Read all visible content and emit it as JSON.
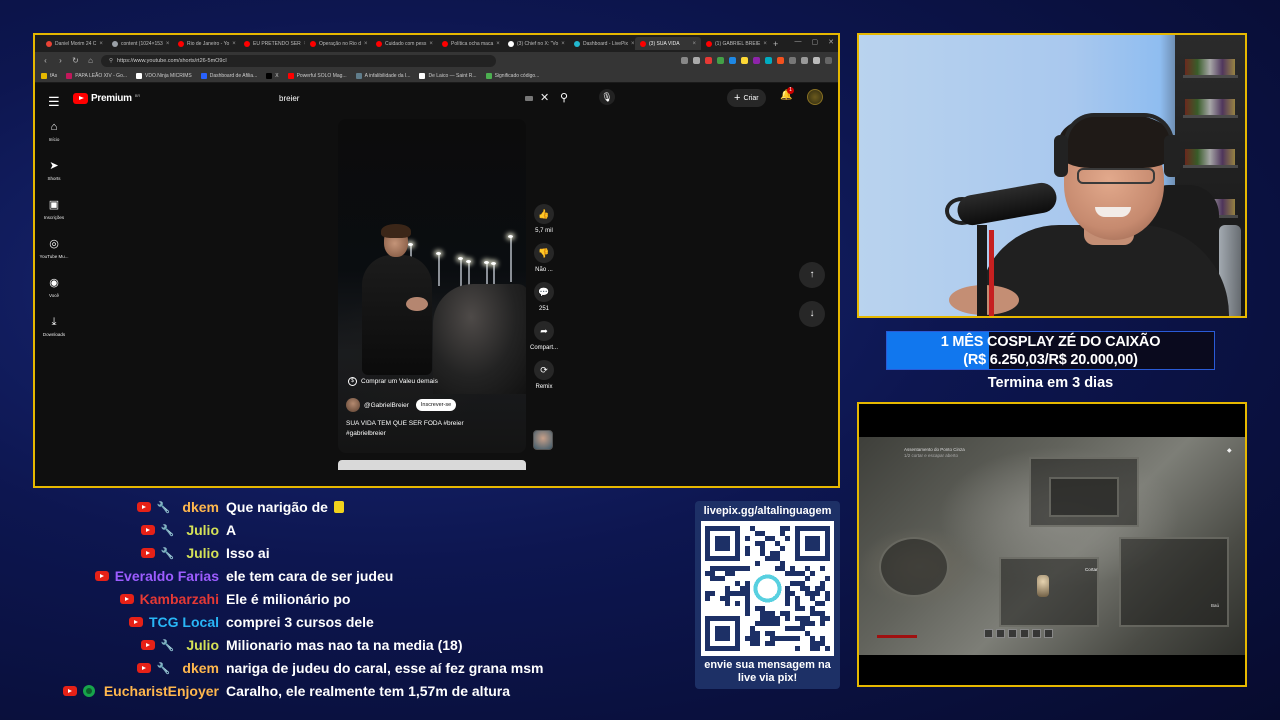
{
  "browser": {
    "tabs": [
      {
        "label": "Daniel Morim 24 C",
        "color": "#ea4335",
        "active": false
      },
      {
        "label": "content (1024×153",
        "color": "#9aa0a6",
        "active": false
      },
      {
        "label": "Rio de Janeiro - Yo",
        "color": "#ff0000",
        "active": false
      },
      {
        "label": "EU PRETENDO SER",
        "color": "#ff0000",
        "active": false
      },
      {
        "label": "Operação no Rio d",
        "color": "#ff0000",
        "active": false
      },
      {
        "label": "Cuidado com pess",
        "color": "#ff0000",
        "active": false
      },
      {
        "label": "Política ocha maca",
        "color": "#ff0000",
        "active": false
      },
      {
        "label": "(3) Chief no X: \"Vo",
        "color": "#ffffff",
        "active": false
      },
      {
        "label": "Dashboard - LivePix",
        "color": "#22b8cf",
        "active": false
      },
      {
        "label": "(3) SUA VIDA",
        "color": "#ff0000",
        "active": true
      },
      {
        "label": "(1) GABRIEL BREIE",
        "color": "#ff0000",
        "active": false
      }
    ],
    "new_tab": "+",
    "window_controls": [
      "—",
      "▢",
      "✕"
    ],
    "address": "https://www.youtube.com/shorts/rt26-5mO9cI",
    "bookmarks": [
      {
        "label": "fAs",
        "color": "#e6b800"
      },
      {
        "label": "PAPA LEÃO XIV - Go...",
        "color": "#c2185b"
      },
      {
        "label": "VDO.Ninja MICRIMS",
        "color": "#ffffff"
      },
      {
        "label": "Dashboard de Afilia...",
        "color": "#2962ff"
      },
      {
        "label": "X",
        "color": "#000000"
      },
      {
        "label": "Powerful SOLO Mag...",
        "color": "#ff0000"
      },
      {
        "label": "A infalibilidade da I...",
        "color": "#607d8b"
      },
      {
        "label": "De Laico — Saint R...",
        "color": "#ffffff"
      },
      {
        "label": "Significado código...",
        "color": "#4caf50"
      }
    ]
  },
  "youtube": {
    "menu_icon": "hamburger-menu-icon",
    "logo_text": "Premium",
    "logo_region": "BR",
    "search_value": "breier",
    "create_label": "Criar",
    "notification_count": "1",
    "nav": [
      {
        "icon": "⌂",
        "icon_name": "home-icon",
        "label": "Início"
      },
      {
        "icon": "➤",
        "icon_name": "shorts-icon",
        "label": "Shorts"
      },
      {
        "icon": "▣",
        "icon_name": "subscriptions-icon",
        "label": "Inscrições"
      },
      {
        "icon": "◎",
        "icon_name": "youtube-music-icon",
        "label": "YouTube Mu..."
      },
      {
        "icon": "◉",
        "icon_name": "you-icon",
        "label": "Você"
      },
      {
        "icon": "⤓",
        "icon_name": "downloads-icon",
        "label": "Downloads"
      }
    ],
    "short": {
      "buy_label": "Comprar um Valeu demais",
      "channel": "@GabrielBreier",
      "subscribe_label": "Inscrever-se",
      "caption_line1": "SUA VIDA TEM QUE SER FODA #breier",
      "caption_line2": "#gabrielbreier"
    },
    "actions": [
      {
        "icon": "👍",
        "icon_name": "like-icon",
        "label": "5,7 mil"
      },
      {
        "icon": "👎",
        "icon_name": "dislike-icon",
        "label": "Não ..."
      },
      {
        "icon": "💬",
        "icon_name": "comment-icon",
        "label": "251"
      },
      {
        "icon": "➦",
        "icon_name": "share-icon",
        "label": "Compart..."
      },
      {
        "icon": "⟳",
        "icon_name": "remix-icon",
        "label": "Remix"
      }
    ]
  },
  "goal": {
    "line1": "1 MÊS COSPLAY ZÉ DO CAIXÃO",
    "line2": "(R$ 6.250,03/R$ 20.000,00)",
    "progress": 0.3125,
    "ends": "Termina em 3 dias"
  },
  "game": {
    "quest_title": "Assentamento do Ponto Cinza",
    "quest_sub": "1/2 cortar e escapar aberto",
    "target_label": "Cortar",
    "item_label": "Baú"
  },
  "chat": [
    {
      "user": "dkem",
      "color": "#ffb74d",
      "badges": [
        "yt",
        "wrench"
      ],
      "text": "Que narigão de",
      "emoji": true
    },
    {
      "user": "Julio",
      "color": "#d4e157",
      "badges": [
        "yt",
        "wrench"
      ],
      "text": "A"
    },
    {
      "user": "Julio",
      "color": "#d4e157",
      "badges": [
        "yt",
        "wrench"
      ],
      "text": "Isso ai"
    },
    {
      "user": "Everaldo Farias",
      "color": "#9c5cff",
      "badges": [
        "yt"
      ],
      "text": "ele tem cara de ser judeu"
    },
    {
      "user": "Kambarzahi",
      "color": "#e53935",
      "badges": [
        "yt"
      ],
      "text": "Ele é milionário po"
    },
    {
      "user": "TCG Local",
      "color": "#29b6f6",
      "badges": [
        "yt"
      ],
      "text": "comprei 3 cursos dele"
    },
    {
      "user": "Julio",
      "color": "#d4e157",
      "badges": [
        "yt",
        "wrench"
      ],
      "text": "Milionario mas nao ta na media (18)"
    },
    {
      "user": "dkem",
      "color": "#ffb74d",
      "badges": [
        "yt",
        "wrench"
      ],
      "text": "nariga de judeu do caral, esse aí fez grana msm"
    },
    {
      "user": "EucharistEnjoyer",
      "color": "#ffb74d",
      "badges": [
        "yt",
        "member"
      ],
      "text": "Caralho, ele realmente tem 1,57m de altura"
    }
  ],
  "livepix": {
    "url": "livepix.gg/altalinguagem",
    "line1": "envie sua mensagem na",
    "line2": "live via pix!"
  },
  "colors": {
    "frame": "#e6b800",
    "goal_fill": "#1177ee",
    "youtube_red": "#ff0000"
  }
}
